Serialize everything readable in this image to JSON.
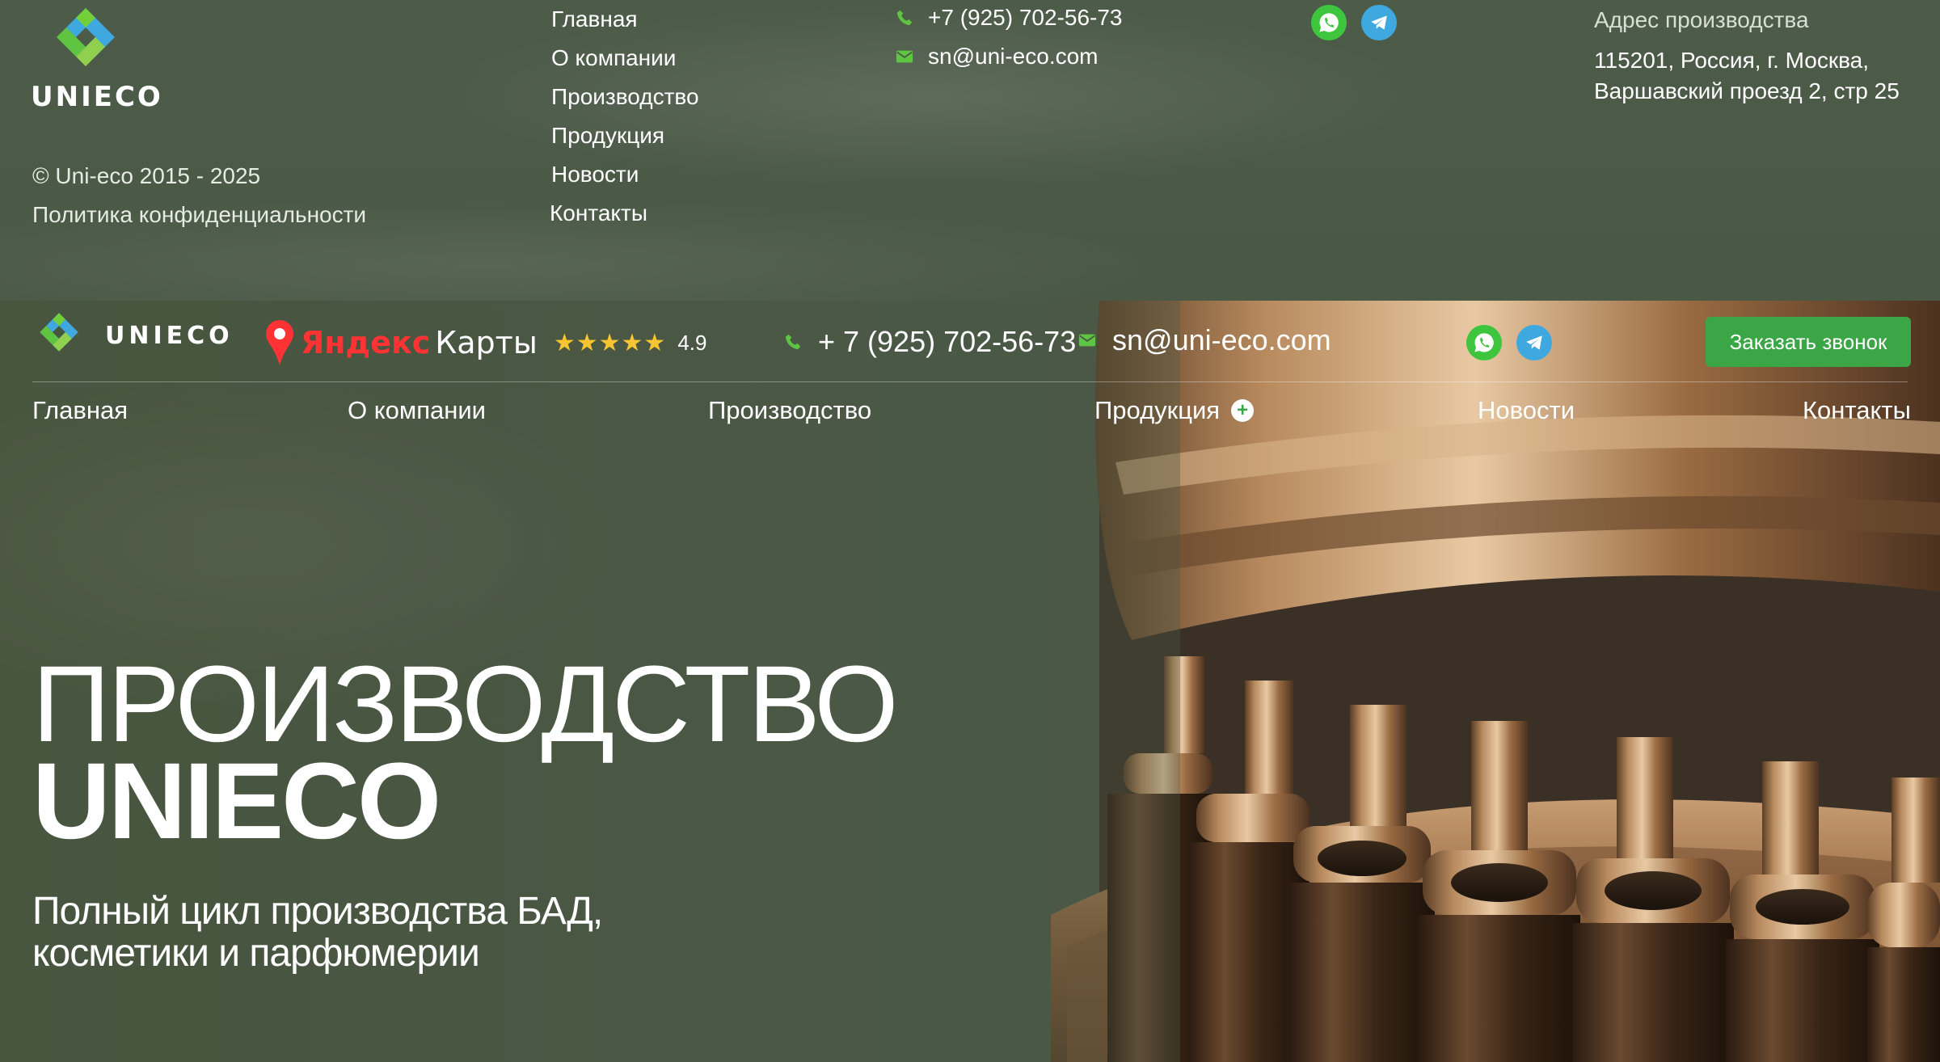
{
  "footer": {
    "logo_text": "UNIECO",
    "copyright": "© Uni-eco 2015 - 2025",
    "privacy": "Политика конфиденциальности",
    "nav": [
      "Главная",
      "О компании",
      "Производство",
      "Продукция",
      "Новости",
      "Контакты"
    ],
    "phone": "+7 (925) 702-56-73",
    "email": "sn@uni-eco.com",
    "address_label": "Адрес производства",
    "address_line1": "115201, Россия, г. Москва,",
    "address_line2": "Варшавский проезд 2, стр 25"
  },
  "header": {
    "logo_text": "UNIECO",
    "maps_brand": "Яндекс",
    "maps_product": "Карты",
    "stars": "★★★★★",
    "rating": "4.9",
    "phone": "+ 7 (925) 702-56-73",
    "email": "sn@uni-eco.com",
    "cta": "Заказать звонок"
  },
  "nav": {
    "home": "Главная",
    "about": "О компании",
    "production": "Производство",
    "products": "Продукция",
    "news": "Новости",
    "contacts": "Контакты"
  },
  "hero": {
    "title_line1": "ПРОИЗВОДСТВО",
    "title_line2": "UNIECO",
    "subtitle_line1": "Полный цикл производства БАД,",
    "subtitle_line2": "косметики и парфюмерии"
  },
  "colors": {
    "accent_green": "#3aa645",
    "whatsapp": "#3ec53e",
    "telegram": "#3fa9df",
    "star": "#f7c531",
    "background": "#4a5846"
  },
  "icons": {
    "phone": "phone-icon",
    "email": "mail-icon",
    "whatsapp": "whatsapp-icon",
    "telegram": "telegram-icon",
    "plus": "plus-icon",
    "maps_pin": "map-pin-icon"
  }
}
